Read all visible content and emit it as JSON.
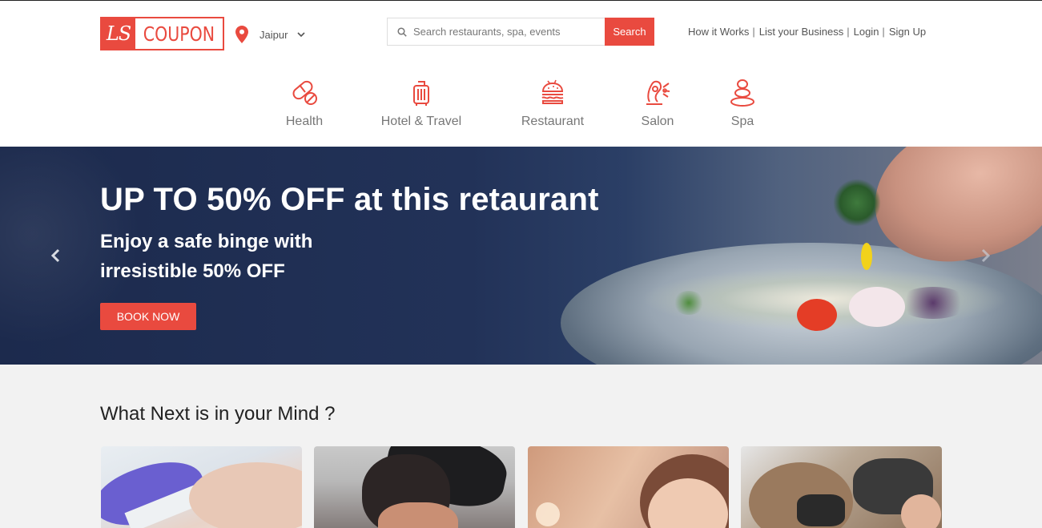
{
  "brand": {
    "mark": "LS",
    "name": "COUPON",
    "color": "#e94a3f"
  },
  "location": {
    "city": "Jaipur"
  },
  "search": {
    "placeholder": "Search restaurants, spa, events",
    "button": "Search"
  },
  "topnav": [
    {
      "label": "How it Works"
    },
    {
      "label": "List your Business"
    },
    {
      "label": "Login"
    },
    {
      "label": "Sign Up"
    }
  ],
  "categories": [
    {
      "label": "Health",
      "icon": "pill-icon"
    },
    {
      "label": "Hotel & Travel",
      "icon": "luggage-icon"
    },
    {
      "label": "Restaurant",
      "icon": "burger-icon"
    },
    {
      "label": "Salon",
      "icon": "salon-chair-icon"
    },
    {
      "label": "Spa",
      "icon": "spa-stones-icon"
    }
  ],
  "hero": {
    "title": "UP TO 50% OFF at this retaurant",
    "subtitle": "Enjoy a safe binge with irresistible 50% OFF",
    "cta": "BOOK NOW"
  },
  "section": {
    "title": "What Next is in your Mind ?"
  },
  "cards": [
    {
      "image": "waxing-treatment-image"
    },
    {
      "image": "barber-haircut-image"
    },
    {
      "image": "facial-treatment-image"
    },
    {
      "image": "hair-drying-image"
    }
  ]
}
